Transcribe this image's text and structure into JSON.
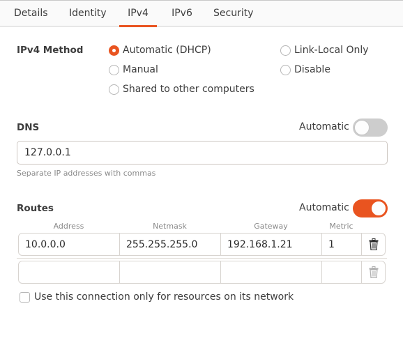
{
  "tabs": [
    {
      "label": "Details",
      "active": false
    },
    {
      "label": "Identity",
      "active": false
    },
    {
      "label": "IPv4",
      "active": true
    },
    {
      "label": "IPv6",
      "active": false
    },
    {
      "label": "Security",
      "active": false
    }
  ],
  "ipv4_method": {
    "label": "IPv4 Method",
    "options": [
      {
        "label": "Automatic (DHCP)",
        "checked": true
      },
      {
        "label": "Manual",
        "checked": false
      },
      {
        "label": "Shared to other computers",
        "checked": false
      },
      {
        "label": "Link-Local Only",
        "checked": false
      },
      {
        "label": "Disable",
        "checked": false
      }
    ]
  },
  "dns": {
    "label": "DNS",
    "automatic_label": "Automatic",
    "automatic_on": false,
    "value": "127.0.0.1",
    "hint": "Separate IP addresses with commas"
  },
  "routes": {
    "label": "Routes",
    "automatic_label": "Automatic",
    "automatic_on": true,
    "columns": [
      "Address",
      "Netmask",
      "Gateway",
      "Metric"
    ],
    "rows": [
      {
        "address": "10.0.0.0",
        "netmask": "255.255.255.0",
        "gateway": "192.168.1.21",
        "metric": "1",
        "delete_enabled": true
      },
      {
        "address": "",
        "netmask": "",
        "gateway": "",
        "metric": "",
        "delete_enabled": false
      }
    ]
  },
  "restrict_checkbox": {
    "label": "Use this connection only for resources on its network",
    "checked": false
  },
  "colors": {
    "accent": "#e95420",
    "toggle_off": "#cdcdcd"
  }
}
